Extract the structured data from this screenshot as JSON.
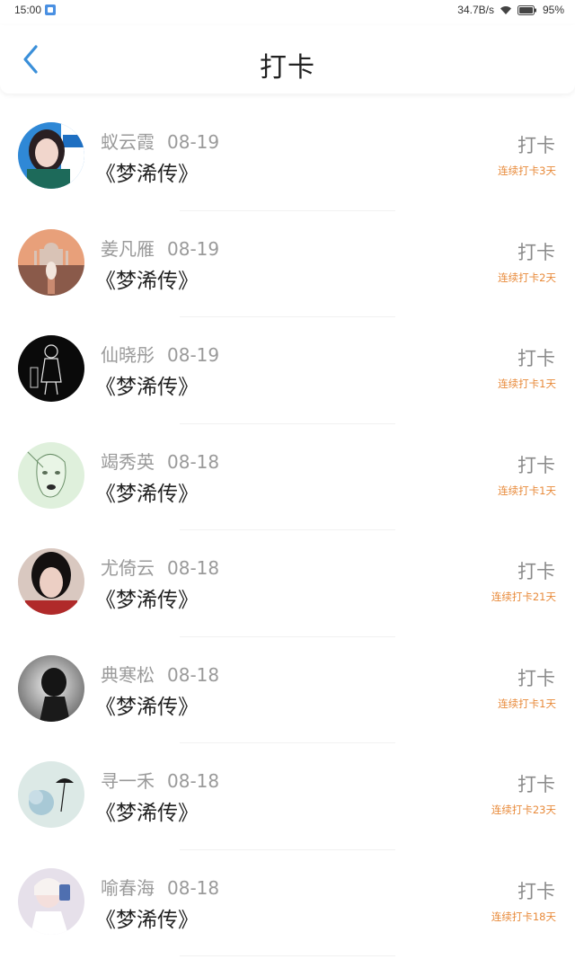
{
  "status_bar": {
    "time": "15:00",
    "net_speed": "34.7B/s",
    "battery": "95%"
  },
  "header": {
    "title": "打卡"
  },
  "items": [
    {
      "name": "蚁云霞",
      "date": "08-19",
      "book": "《梦浠传》",
      "action": "打卡",
      "streak": "连续打卡3天"
    },
    {
      "name": "姜凡雁",
      "date": "08-19",
      "book": "《梦浠传》",
      "action": "打卡",
      "streak": "连续打卡2天"
    },
    {
      "name": "仙晓彤",
      "date": "08-19",
      "book": "《梦浠传》",
      "action": "打卡",
      "streak": "连续打卡1天"
    },
    {
      "name": "竭秀英",
      "date": "08-18",
      "book": "《梦浠传》",
      "action": "打卡",
      "streak": "连续打卡1天"
    },
    {
      "name": "尤倚云",
      "date": "08-18",
      "book": "《梦浠传》",
      "action": "打卡",
      "streak": "连续打卡21天"
    },
    {
      "name": "典寒松",
      "date": "08-18",
      "book": "《梦浠传》",
      "action": "打卡",
      "streak": "连续打卡1天"
    },
    {
      "name": "寻一禾",
      "date": "08-18",
      "book": "《梦浠传》",
      "action": "打卡",
      "streak": "连续打卡23天"
    },
    {
      "name": "喻春海",
      "date": "08-18",
      "book": "《梦浠传》",
      "action": "打卡",
      "streak": "连续打卡18天"
    }
  ],
  "colors": {
    "accent": "#3a8fd9",
    "streak": "#e88a3a"
  }
}
